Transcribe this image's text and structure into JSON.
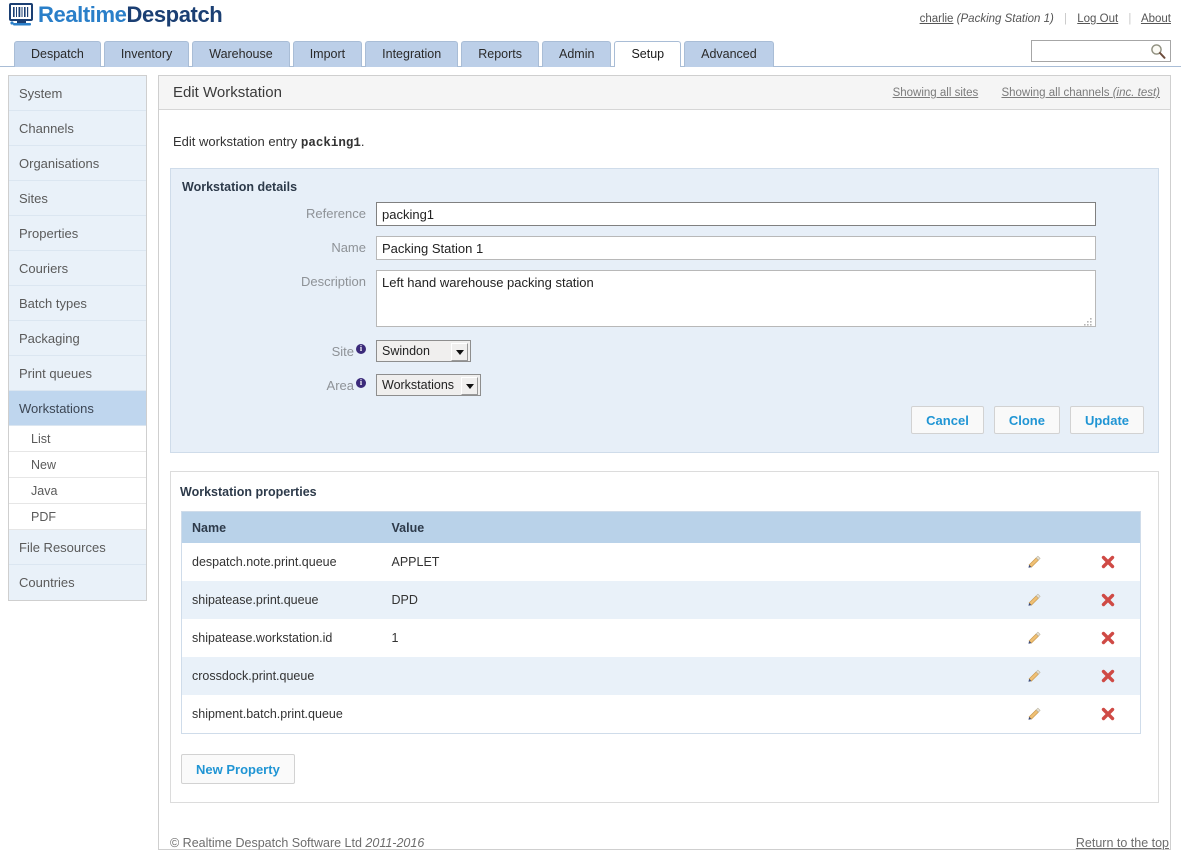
{
  "brand": {
    "name_part1": "Realtime",
    "name_part2": "Despatch",
    "logo_icon": "barcode-monitor-icon"
  },
  "header": {
    "user": "charlie",
    "workstation": "(Packing Station 1)",
    "logout_label": "Log Out",
    "about_label": "About",
    "search_placeholder": "",
    "search_value": "",
    "search_icon": "magnifier-icon"
  },
  "tabs": [
    {
      "label": "Despatch",
      "active": false
    },
    {
      "label": "Inventory",
      "active": false
    },
    {
      "label": "Warehouse",
      "active": false
    },
    {
      "label": "Import",
      "active": false
    },
    {
      "label": "Integration",
      "active": false
    },
    {
      "label": "Reports",
      "active": false
    },
    {
      "label": "Admin",
      "active": false
    },
    {
      "label": "Setup",
      "active": true
    },
    {
      "label": "Advanced",
      "active": false
    }
  ],
  "sidebar": {
    "items": [
      {
        "label": "System",
        "active": false
      },
      {
        "label": "Channels",
        "active": false
      },
      {
        "label": "Organisations",
        "active": false
      },
      {
        "label": "Sites",
        "active": false
      },
      {
        "label": "Properties",
        "active": false
      },
      {
        "label": "Couriers",
        "active": false
      },
      {
        "label": "Batch types",
        "active": false
      },
      {
        "label": "Packaging",
        "active": false
      },
      {
        "label": "Print queues",
        "active": false
      },
      {
        "label": "Workstations",
        "active": true
      },
      {
        "label": "File Resources",
        "active": false
      },
      {
        "label": "Countries",
        "active": false
      }
    ],
    "sub_items": [
      {
        "label": "List"
      },
      {
        "label": "New"
      },
      {
        "label": "Java"
      },
      {
        "label": "PDF"
      }
    ]
  },
  "content": {
    "title": "Edit Workstation",
    "showing_sites": "Showing all sites",
    "showing_channels_main": "Showing all channels ",
    "showing_channels_italic": "(inc. test)",
    "intro_prefix": "Edit workstation entry ",
    "intro_entry": "packing1",
    "intro_suffix": "."
  },
  "details": {
    "section_title": "Workstation details",
    "fields": {
      "reference_label": "Reference",
      "reference_value": "packing1",
      "name_label": "Name",
      "name_value": "Packing Station 1",
      "description_label": "Description",
      "description_value": "Left hand warehouse packing station",
      "site_label": "Site",
      "site_value": "Swindon",
      "area_label": "Area",
      "area_value": "Workstations"
    },
    "buttons": {
      "cancel": "Cancel",
      "clone": "Clone",
      "update": "Update"
    }
  },
  "properties": {
    "section_title": "Workstation properties",
    "columns": [
      "Name",
      "Value"
    ],
    "rows": [
      {
        "name": "despatch.note.print.queue",
        "value": "APPLET"
      },
      {
        "name": "shipatease.print.queue",
        "value": "DPD"
      },
      {
        "name": "shipatease.workstation.id",
        "value": "1"
      },
      {
        "name": "crossdock.print.queue",
        "value": ""
      },
      {
        "name": "shipment.batch.print.queue",
        "value": ""
      }
    ],
    "edit_icon": "pencil-icon",
    "delete_icon": "red-cross-icon",
    "new_property_label": "New Property"
  },
  "footer": {
    "copyright": "© Realtime Despatch Software Ltd ",
    "years": "2011-2016",
    "return_top": "Return to the top"
  },
  "colors": {
    "brand_light_blue": "#2a7fc9",
    "brand_dark_blue": "#1b3f73",
    "tab_blue": "#bccfe8",
    "panel_blue": "#e7eff8",
    "table_header_blue": "#b9d2e9",
    "row_alt_blue": "#e9f1f9",
    "button_text": "#2095d4",
    "delete_red": "#d9534f",
    "sidebar_active": "#bfd6ee"
  }
}
